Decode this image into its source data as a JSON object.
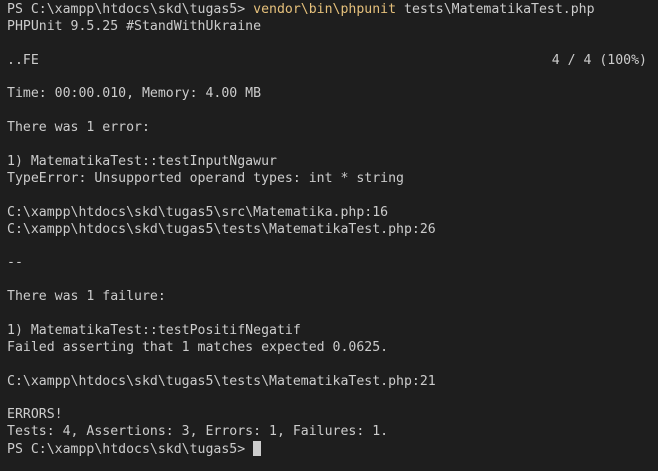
{
  "terminal": {
    "prompt1": "PS C:\\xampp\\htdocs\\skd\\tugas5> ",
    "command": "vendor\\bin\\phpunit",
    "command_args": " tests\\MatematikaTest.php",
    "version": "PHPUnit 9.5.25 #StandWithUkraine",
    "progress_marks": "..FE",
    "progress_count": "4 / 4 (100%)",
    "time_memory": "Time: 00:00.010, Memory: 4.00 MB",
    "error_header": "There was 1 error:",
    "error_test": "1) MatematikaTest::testInputNgawur",
    "error_message": "TypeError: Unsupported operand types: int * string",
    "error_trace_1": "C:\\xampp\\htdocs\\skd\\tugas5\\src\\Matematika.php:16",
    "error_trace_2": "C:\\xampp\\htdocs\\skd\\tugas5\\tests\\MatematikaTest.php:26",
    "separator": "--",
    "failure_header": "There was 1 failure:",
    "failure_test": "1) MatematikaTest::testPositifNegatif",
    "failure_message": "Failed asserting that 1 matches expected 0.0625.",
    "failure_trace_1": "C:\\xampp\\htdocs\\skd\\tugas5\\tests\\MatematikaTest.php:21",
    "result_label": "ERRORS!",
    "summary": "Tests: 4, Assertions: 3, Errors: 1, Failures: 1.",
    "prompt2": "PS C:\\xampp\\htdocs\\skd\\tugas5> "
  },
  "colors": {
    "background": "#1e1e1e",
    "text": "#cccccc",
    "command": "#e5c07b"
  }
}
